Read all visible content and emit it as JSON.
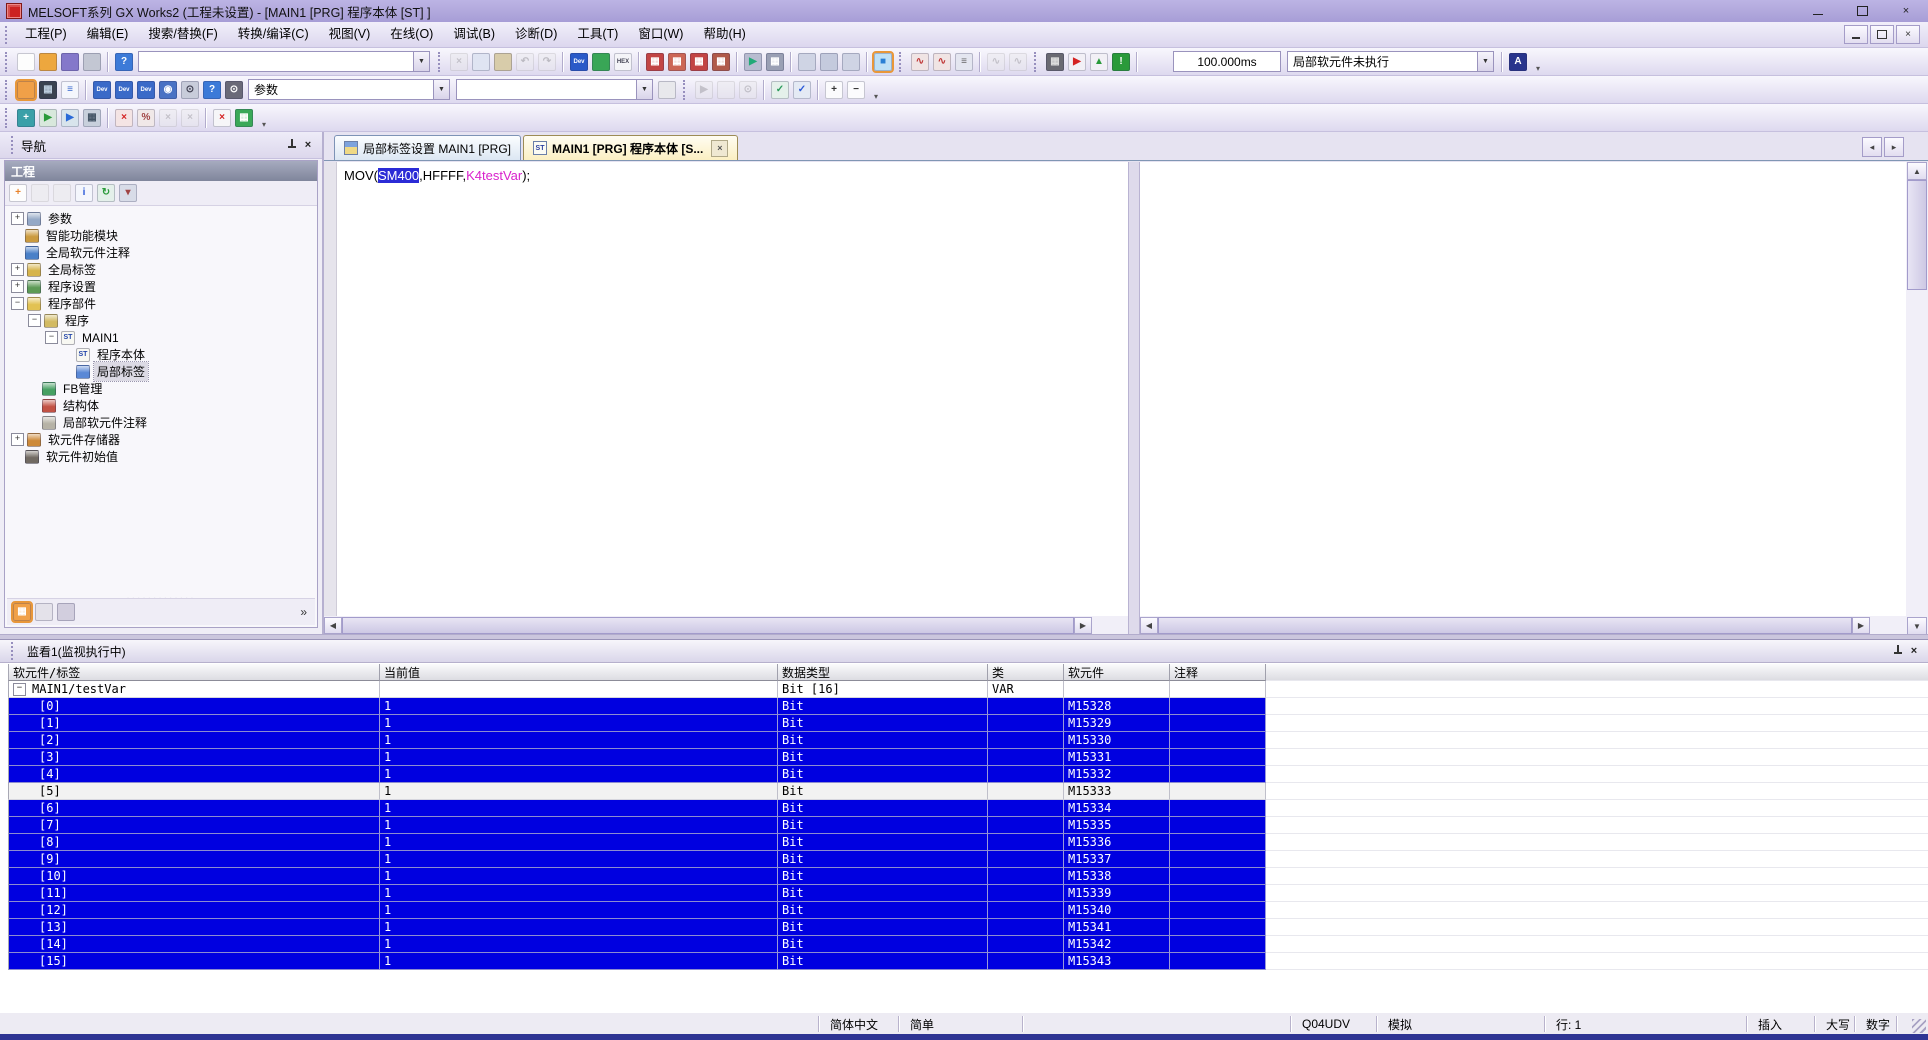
{
  "window": {
    "title": "MELSOFT系列 GX Works2 (工程未设置) - [MAIN1 [PRG] 程序本体 [ST] ]"
  },
  "menu": {
    "items": [
      "工程(P)",
      "编辑(E)",
      "搜索/替换(F)",
      "转换/编译(C)",
      "视图(V)",
      "在线(O)",
      "调试(B)",
      "诊断(D)",
      "工具(T)",
      "窗口(W)",
      "帮助(H)"
    ]
  },
  "toolbars": {
    "row1": [
      {
        "t": "grip"
      },
      {
        "t": "icon",
        "name": "new-project-icon",
        "glyph": "",
        "bg": "#fdfdfd",
        "fg": "#555"
      },
      {
        "t": "icon",
        "name": "open-project-icon",
        "glyph": "",
        "bg": "#eda73e",
        "fg": "#fff"
      },
      {
        "t": "icon",
        "name": "save-project-icon",
        "glyph": "",
        "bg": "#8478ca",
        "fg": "#fff"
      },
      {
        "t": "icon",
        "name": "print-icon",
        "glyph": "",
        "bg": "#c3c7d3",
        "fg": "#444"
      },
      {
        "t": "sep"
      },
      {
        "t": "icon",
        "name": "help-icon",
        "glyph": "?",
        "bg": "#3c7ad8",
        "fg": "#fff"
      },
      {
        "t": "combo",
        "name": "window-select",
        "value": ""
      },
      {
        "t": "grip"
      },
      {
        "t": "icon",
        "name": "cut-icon",
        "glyph": "×",
        "bg": "#e8e6ee",
        "fg": "#888",
        "dim": true
      },
      {
        "t": "icon",
        "name": "copy-icon",
        "glyph": "",
        "bg": "#dfe4f2",
        "fg": "#456"
      },
      {
        "t": "icon",
        "name": "paste-icon",
        "glyph": "",
        "bg": "#d8ccaa",
        "fg": "#456"
      },
      {
        "t": "icon",
        "name": "undo-icon",
        "glyph": "↶",
        "bg": "#eceaf2",
        "fg": "#777",
        "dim": true
      },
      {
        "t": "icon",
        "name": "redo-icon",
        "glyph": "↷",
        "bg": "#eceaf2",
        "fg": "#777",
        "dim": true
      },
      {
        "t": "sep"
      },
      {
        "t": "icon",
        "name": "device-display-icon",
        "glyph": "Dev",
        "bg": "#2a5ac8",
        "fg": "#fff"
      },
      {
        "t": "icon",
        "name": "monitor-mode-icon",
        "glyph": "",
        "bg": "#39a656",
        "fg": "#fff"
      },
      {
        "t": "icon",
        "name": "hex-display-icon",
        "glyph": "HEX",
        "bg": "#f4f4f8",
        "fg": "#445"
      },
      {
        "t": "sep"
      },
      {
        "t": "icon",
        "name": "device-test-1-icon",
        "glyph": "▦",
        "bg": "#c24444",
        "fg": "#fff"
      },
      {
        "t": "icon",
        "name": "device-test-2-icon",
        "glyph": "▦",
        "bg": "#cc6655",
        "fg": "#fff"
      },
      {
        "t": "icon",
        "name": "device-test-3-icon",
        "glyph": "▦",
        "bg": "#c24444",
        "fg": "#fff"
      },
      {
        "t": "icon",
        "name": "device-test-4-icon",
        "glyph": "▦",
        "bg": "#b05a4a",
        "fg": "#fff"
      },
      {
        "t": "sep"
      },
      {
        "t": "icon",
        "name": "monitor-start-icon",
        "glyph": "▶",
        "bg": "#b8bcd0",
        "fg": "#2a7"
      },
      {
        "t": "icon",
        "name": "monitor-stop-icon",
        "glyph": "▦",
        "bg": "#9aa0b4",
        "fg": "#fff"
      },
      {
        "t": "sep"
      },
      {
        "t": "icon",
        "name": "program-window-1-icon",
        "glyph": "",
        "bg": "#cfd4e4",
        "fg": "#445"
      },
      {
        "t": "icon",
        "name": "program-window-2-icon",
        "glyph": "",
        "bg": "#c4cadd",
        "fg": "#445"
      },
      {
        "t": "icon",
        "name": "program-window-3-icon",
        "glyph": "",
        "bg": "#cfd4e4",
        "fg": "#445"
      },
      {
        "t": "sep"
      },
      {
        "t": "icon",
        "name": "st-view-icon",
        "glyph": "■",
        "bg": "#bfe0f6",
        "fg": "#2a7fd4",
        "frame": true
      },
      {
        "t": "grip"
      },
      {
        "t": "icon",
        "name": "trace-1-icon",
        "glyph": "∿",
        "bg": "#f0e4e4",
        "fg": "#c03838"
      },
      {
        "t": "icon",
        "name": "trace-2-icon",
        "glyph": "∿",
        "bg": "#f0e4e4",
        "fg": "#c03838"
      },
      {
        "t": "icon",
        "name": "timing-chart-icon",
        "glyph": "≡",
        "bg": "#e4e6f0",
        "fg": "#666"
      },
      {
        "t": "sep"
      },
      {
        "t": "icon",
        "name": "wave-1-icon",
        "glyph": "∿",
        "bg": "#eceaf2",
        "fg": "#888",
        "dim": true
      },
      {
        "t": "icon",
        "name": "wave-2-icon",
        "glyph": "∿",
        "bg": "#eceaf2",
        "fg": "#888",
        "dim": true
      },
      {
        "t": "grip"
      },
      {
        "t": "icon",
        "name": "dot-matrix-icon",
        "glyph": "▦",
        "bg": "#6a6a72",
        "fg": "#ddd"
      },
      {
        "t": "icon",
        "name": "simulation-run-icon",
        "glyph": "▶",
        "bg": "#f2f0f6",
        "fg": "#d42222"
      },
      {
        "t": "icon",
        "name": "simulation-warn-icon",
        "glyph": "▲",
        "bg": "#f2f0f6",
        "fg": "#2a9a3a"
      },
      {
        "t": "icon",
        "name": "simulation-info-icon",
        "glyph": "!",
        "bg": "#2a9a3a",
        "fg": "#fff"
      },
      {
        "t": "sep"
      },
      {
        "t": "space",
        "w": 28
      },
      {
        "t": "box",
        "name": "scan-time",
        "value": "100.000ms"
      },
      {
        "t": "combo",
        "name": "device-exec",
        "value": "局部软元件未执行"
      },
      {
        "t": "sep"
      },
      {
        "t": "icon",
        "name": "device-display-switch-icon",
        "glyph": "A",
        "bg": "#28348c",
        "fg": "#fff"
      },
      {
        "t": "ovf"
      }
    ],
    "row2": [
      {
        "t": "grip"
      },
      {
        "t": "icon",
        "name": "project-tree-icon",
        "glyph": "",
        "bg": "#f0a048",
        "fg": "#fff",
        "frame": true
      },
      {
        "t": "icon",
        "name": "module-configuration-icon",
        "glyph": "▦",
        "bg": "#3a4250",
        "fg": "#bcd"
      },
      {
        "t": "icon",
        "name": "list-view-icon",
        "glyph": "≡",
        "bg": "#f4f6fc",
        "fg": "#36c"
      },
      {
        "t": "sep"
      },
      {
        "t": "icon",
        "name": "device-comment-icon",
        "glyph": "Dev",
        "bg": "#3a6ac8",
        "fg": "#fff"
      },
      {
        "t": "icon",
        "name": "device-memory-icon",
        "glyph": "Dev",
        "bg": "#3a6ac8",
        "fg": "#fff"
      },
      {
        "t": "icon",
        "name": "device-grid-icon",
        "glyph": "Dev",
        "bg": "#3a6ac8",
        "fg": "#fff"
      },
      {
        "t": "icon",
        "name": "device-watch-icon",
        "glyph": "◉",
        "bg": "#4a72c4",
        "fg": "#fff"
      },
      {
        "t": "icon",
        "name": "device-find-icon",
        "glyph": "⊙",
        "bg": "#c8ccda",
        "fg": "#445"
      },
      {
        "t": "icon",
        "name": "help2-icon",
        "glyph": "?",
        "bg": "#3c7ad8",
        "fg": "#fff"
      },
      {
        "t": "icon",
        "name": "cross-reference-icon",
        "glyph": "⊙",
        "bg": "#6a6a78",
        "fg": "#fff"
      },
      {
        "t": "combo",
        "name": "program-select",
        "value": "参数"
      },
      {
        "t": "combo",
        "name": "compile-select",
        "value": ""
      },
      {
        "t": "icon",
        "name": "clipboard-icon",
        "glyph": "",
        "bg": "#e8e8ec",
        "fg": "#555"
      },
      {
        "t": "grip"
      },
      {
        "t": "icon",
        "name": "convert-icon",
        "glyph": "▶",
        "bg": "#eceaf2",
        "fg": "#888",
        "dim": true
      },
      {
        "t": "icon",
        "name": "build-icon",
        "glyph": "",
        "bg": "#eceaf2",
        "fg": "#888",
        "dim": true
      },
      {
        "t": "icon",
        "name": "rebuild-find-icon",
        "glyph": "⊙",
        "bg": "#eceaf2",
        "fg": "#888",
        "dim": true
      },
      {
        "t": "sep"
      },
      {
        "t": "icon",
        "name": "check-program-icon",
        "glyph": "✓",
        "bg": "#e4f0ea",
        "fg": "#2a9a5a"
      },
      {
        "t": "icon",
        "name": "check-parameter-icon",
        "glyph": "✓",
        "bg": "#e4eaf4",
        "fg": "#2a5ad8"
      },
      {
        "t": "sep"
      },
      {
        "t": "icon",
        "name": "zoom-in-icon",
        "glyph": "+",
        "bg": "#fbfbfd",
        "fg": "#333"
      },
      {
        "t": "icon",
        "name": "zoom-out-icon",
        "glyph": "−",
        "bg": "#fbfbfd",
        "fg": "#333"
      },
      {
        "t": "ovf"
      }
    ],
    "row3": [
      {
        "t": "grip"
      },
      {
        "t": "icon",
        "name": "step-insert-icon",
        "glyph": "+",
        "bg": "#3aa0a8",
        "fg": "#fff"
      },
      {
        "t": "icon",
        "name": "step-run-icon",
        "glyph": "▶",
        "bg": "#d8e8dc",
        "fg": "#2a9a3a"
      },
      {
        "t": "icon",
        "name": "step-into-icon",
        "glyph": "▶",
        "bg": "#d8e4ec",
        "fg": "#2a6ad8"
      },
      {
        "t": "icon",
        "name": "step-over-icon",
        "glyph": "▦",
        "bg": "#c8d0dc",
        "fg": "#456"
      },
      {
        "t": "sep"
      },
      {
        "t": "icon",
        "name": "break-point-icon",
        "glyph": "×",
        "bg": "#f4e4e4",
        "fg": "#d42222"
      },
      {
        "t": "icon",
        "name": "break-condition-icon",
        "glyph": "%",
        "bg": "#f0e8e8",
        "fg": "#a04444"
      },
      {
        "t": "icon",
        "name": "skip-range-1-icon",
        "glyph": "×",
        "bg": "#eceaf2",
        "fg": "#888",
        "dim": true
      },
      {
        "t": "icon",
        "name": "skip-range-2-icon",
        "glyph": "×",
        "bg": "#eceaf2",
        "fg": "#888",
        "dim": true
      },
      {
        "t": "sep"
      },
      {
        "t": "icon",
        "name": "watch-delete-icon",
        "glyph": "×",
        "bg": "#f6f6f8",
        "fg": "#d42222"
      },
      {
        "t": "icon",
        "name": "watch-register-icon",
        "glyph": "▦",
        "bg": "#3aa858",
        "fg": "#fff"
      },
      {
        "t": "ovf"
      }
    ]
  },
  "navigation": {
    "title": "导航",
    "section": "工程",
    "tools": [
      {
        "name": "new-item-icon",
        "glyph": "+",
        "bg": "#fdfdfd",
        "fg": "#e8822a"
      },
      {
        "name": "copy-item-icon",
        "glyph": "",
        "bg": "#eceaf2",
        "fg": "#888",
        "dim": true
      },
      {
        "name": "paste-item-icon",
        "glyph": "",
        "bg": "#eceaf2",
        "fg": "#888",
        "dim": true
      },
      {
        "name": "property-icon",
        "glyph": "i",
        "bg": "#f4f6fc",
        "fg": "#2a5ad8"
      },
      {
        "name": "refresh-icon",
        "glyph": "↻",
        "bg": "#e4f0ea",
        "fg": "#2a9a3a"
      },
      {
        "name": "sort-icon",
        "glyph": "▾",
        "bg": "#d8dce8",
        "fg": "#a04444"
      }
    ],
    "tree": [
      {
        "label": "参数",
        "depth": 0,
        "exp": "plus",
        "icon": "parameter-icon",
        "color": "#94a8c6"
      },
      {
        "label": "智能功能模块",
        "depth": 0,
        "exp": "none",
        "icon": "intelligent-module-icon",
        "color": "#cb9a3e"
      },
      {
        "label": "全局软元件注释",
        "depth": 0,
        "exp": "none",
        "icon": "global-device-comment-icon",
        "color": "#4a80c8"
      },
      {
        "label": "全局标签",
        "depth": 0,
        "exp": "plus",
        "icon": "global-label-icon",
        "color": "#d6b44c"
      },
      {
        "label": "程序设置",
        "depth": 0,
        "exp": "plus",
        "icon": "program-setting-icon",
        "color": "#5c9a56"
      },
      {
        "label": "程序部件",
        "depth": 0,
        "exp": "minus",
        "icon": "pou-icon",
        "color": "#e2c252"
      },
      {
        "label": "程序",
        "depth": 1,
        "exp": "minus",
        "icon": "program-folder-icon",
        "color": "#d2ba62"
      },
      {
        "label": "MAIN1",
        "depth": 2,
        "exp": "minus",
        "icon": "st-program-icon",
        "badge": "ST"
      },
      {
        "label": "程序本体",
        "depth": 3,
        "exp": "none",
        "icon": "program-body-icon",
        "badge": "ST"
      },
      {
        "label": "局部标签",
        "depth": 3,
        "exp": "none",
        "icon": "local-label-icon",
        "color": "#5a88d6",
        "selected": true
      },
      {
        "label": "FB管理",
        "depth": 1,
        "exp": "none",
        "icon": "fb-pool-icon",
        "color": "#46a062"
      },
      {
        "label": "结构体",
        "depth": 1,
        "exp": "none",
        "icon": "structure-icon",
        "color": "#c25244"
      },
      {
        "label": "局部软元件注释",
        "depth": 1,
        "exp": "none",
        "icon": "local-device-comment-icon",
        "color": "#b6b2a6"
      },
      {
        "label": "软元件存储器",
        "depth": 0,
        "exp": "plus",
        "icon": "device-memory-tree-icon",
        "color": "#cd8a3a"
      },
      {
        "label": "软元件初始值",
        "depth": 0,
        "exp": "none",
        "icon": "device-initial-value-icon",
        "color": "#716a62"
      }
    ],
    "bottom_tools": [
      {
        "name": "project-view-icon",
        "glyph": "▦",
        "bg": "#f0a048",
        "fg": "#fff",
        "frame": true
      },
      {
        "name": "user-library-view-icon",
        "glyph": "",
        "bg": "#e4e2ea",
        "fg": "#666"
      },
      {
        "name": "connection-view-icon",
        "glyph": "",
        "bg": "#d2cede",
        "fg": "#666"
      }
    ],
    "more_label": "»"
  },
  "tabs": [
    {
      "label": "局部标签设置 MAIN1 [PRG]",
      "active": false
    },
    {
      "label": "MAIN1 [PRG] 程序本体 [S...",
      "active": true,
      "icon_text": "ST"
    }
  ],
  "editor": {
    "code": {
      "prefix": "MOV(",
      "selected": "SM400",
      "middle": ",HFFFF,",
      "label": "K4testVar",
      "suffix": ");"
    }
  },
  "watch": {
    "title": "监看1(监视执行中)",
    "columns": [
      "软元件/标签",
      "当前值",
      "数据类型",
      "类",
      "软元件",
      "注释"
    ],
    "root": {
      "label": "MAIN1/testVar",
      "data_type": "Bit [16]",
      "class": "VAR"
    },
    "rows": [
      {
        "index": "[0]",
        "value": "1",
        "type": "Bit",
        "device": "M15328",
        "highlighted": true
      },
      {
        "index": "[1]",
        "value": "1",
        "type": "Bit",
        "device": "M15329",
        "highlighted": true
      },
      {
        "index": "[2]",
        "value": "1",
        "type": "Bit",
        "device": "M15330",
        "highlighted": true
      },
      {
        "index": "[3]",
        "value": "1",
        "type": "Bit",
        "device": "M15331",
        "highlighted": true
      },
      {
        "index": "[4]",
        "value": "1",
        "type": "Bit",
        "device": "M15332",
        "highlighted": true
      },
      {
        "index": "[5]",
        "value": "1",
        "type": "Bit",
        "device": "M15333",
        "highlighted": false
      },
      {
        "index": "[6]",
        "value": "1",
        "type": "Bit",
        "device": "M15334",
        "highlighted": true
      },
      {
        "index": "[7]",
        "value": "1",
        "type": "Bit",
        "device": "M15335",
        "highlighted": true
      },
      {
        "index": "[8]",
        "value": "1",
        "type": "Bit",
        "device": "M15336",
        "highlighted": true
      },
      {
        "index": "[9]",
        "value": "1",
        "type": "Bit",
        "device": "M15337",
        "highlighted": true
      },
      {
        "index": "[10]",
        "value": "1",
        "type": "Bit",
        "device": "M15338",
        "highlighted": true
      },
      {
        "index": "[11]",
        "value": "1",
        "type": "Bit",
        "device": "M15339",
        "highlighted": true
      },
      {
        "index": "[12]",
        "value": "1",
        "type": "Bit",
        "device": "M15340",
        "highlighted": true
      },
      {
        "index": "[13]",
        "value": "1",
        "type": "Bit",
        "device": "M15341",
        "highlighted": true
      },
      {
        "index": "[14]",
        "value": "1",
        "type": "Bit",
        "device": "M15342",
        "highlighted": true
      },
      {
        "index": "[15]",
        "value": "1",
        "type": "Bit",
        "device": "M15343",
        "highlighted": true
      }
    ]
  },
  "status_bar": {
    "language": "简体中文",
    "edit_mode": "简单",
    "cpu_type": "Q04UDV",
    "connection": "模拟",
    "line": "行: 1",
    "insert_mode": "插入",
    "caps": "大写",
    "num": "数字"
  },
  "colors": {
    "highlight_row": "#0000e0",
    "selection": "#2b2bd6",
    "label_text": "#d922cc",
    "titlebar": "#afa5dc"
  }
}
